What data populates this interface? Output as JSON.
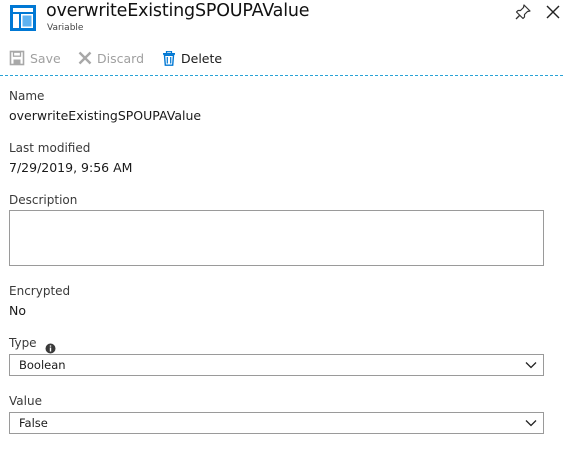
{
  "header": {
    "title": "overwriteExistingSPOUPAValue",
    "subtitle": "Variable",
    "icons": {
      "app": "variable-blade-icon",
      "pin": "pin-icon",
      "close": "close-icon"
    }
  },
  "toolbar": {
    "save_label": "Save",
    "discard_label": "Discard",
    "delete_label": "Delete",
    "icons": {
      "save": "save-icon",
      "discard": "discard-icon",
      "delete": "trash-icon"
    },
    "disabled_color": "#a0a0a0",
    "accent_color": "#0078d4"
  },
  "fields": {
    "name": {
      "label": "Name",
      "value": "overwriteExistingSPOUPAValue"
    },
    "last_modified": {
      "label": "Last modified",
      "value": "7/29/2019, 9:56 AM"
    },
    "description": {
      "label": "Description",
      "value": ""
    },
    "encrypted": {
      "label": "Encrypted",
      "value": "No"
    },
    "type": {
      "label": "Type",
      "selected": "Boolean",
      "icon": "info-icon"
    },
    "value": {
      "label": "Value",
      "selected": "False"
    }
  }
}
